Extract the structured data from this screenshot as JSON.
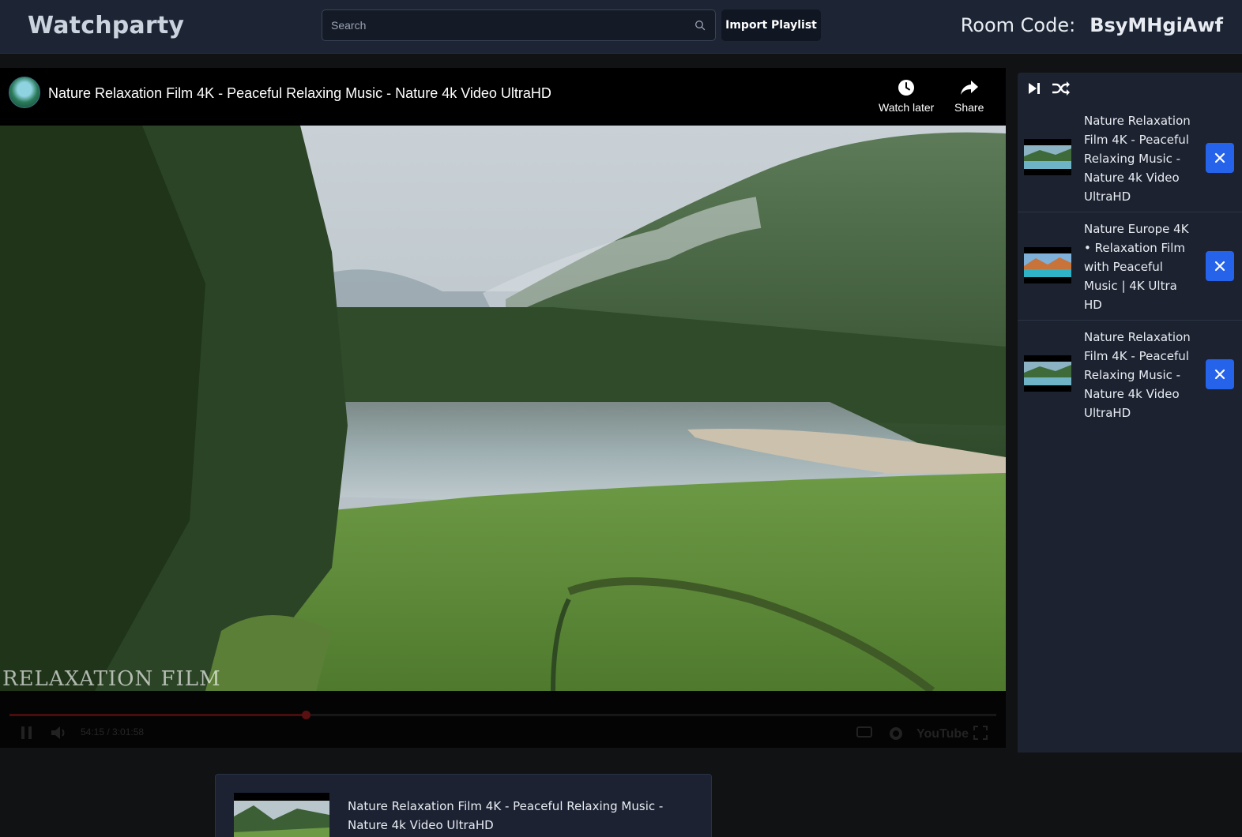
{
  "app": {
    "brand": "Watchparty"
  },
  "search": {
    "placeholder": "Search",
    "value": ""
  },
  "header": {
    "import_label": "Import Playlist",
    "room_label": "Room Code:",
    "room_code": "BsyMHgiAwf"
  },
  "player": {
    "title": "Nature Relaxation Film 4K - Peaceful Relaxing Music - Nature 4k Video UltraHD",
    "watch_later_label": "Watch later",
    "share_label": "Share",
    "watermark": "RELAXATION FILM",
    "time_display": "54:15 / 3:01:58",
    "progress": 0.3,
    "youtube_label": "YouTube",
    "icons": [
      "clock-icon",
      "share-arrow-icon",
      "pause-icon",
      "volume-icon",
      "captions-icon",
      "settings-gear-icon",
      "fullscreen-icon"
    ]
  },
  "queue": {
    "icons": [
      "skip-next-icon",
      "shuffle-icon"
    ],
    "items": [
      {
        "title": "Nature Relaxation Film 4K - Peaceful Relaxing Music - Nature 4k Video UltraHD"
      },
      {
        "title": "Nature Europe 4K • Relaxation Film with Peaceful Music | 4K Ultra HD"
      },
      {
        "title": "Nature Relaxation Film 4K - Peaceful Relaxing Music - Nature 4k Video UltraHD"
      }
    ]
  },
  "now_playing": {
    "title": "Nature Relaxation Film 4K - Peaceful Relaxing Music - Nature 4k Video UltraHD"
  },
  "colors": {
    "header_bg": "#1d2534",
    "page_bg": "#111214",
    "panel_bg": "#1c2230",
    "remove_button": "#2563eb"
  }
}
